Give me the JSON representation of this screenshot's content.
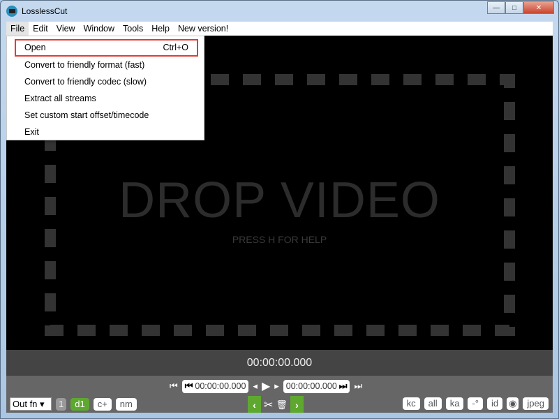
{
  "window": {
    "title": "LosslessCut",
    "minimize": "—",
    "maximize": "□",
    "close": "✕"
  },
  "menubar": [
    "File",
    "Edit",
    "View",
    "Window",
    "Tools",
    "Help",
    "New version!"
  ],
  "file_menu": [
    {
      "label": "Open",
      "shortcut": "Ctrl+O"
    },
    {
      "label": "Convert to friendly format (fast)",
      "shortcut": ""
    },
    {
      "label": "Convert to friendly codec (slow)",
      "shortcut": ""
    },
    {
      "label": "Extract all streams",
      "shortcut": ""
    },
    {
      "label": "Set custom start offset/timecode",
      "shortcut": ""
    },
    {
      "label": "Exit",
      "shortcut": ""
    }
  ],
  "stage": {
    "drop_text": "DROP VIDEO",
    "help_text": "PRESS H FOR HELP"
  },
  "timecode": "00:00:00.000",
  "controls": {
    "cut_start": "00:00:00.000",
    "cut_end": "00:00:00.000",
    "output_format": "Out fn",
    "segment_num": "1",
    "d1": "d1",
    "cplus": "c+",
    "nm": "nm",
    "prev": "‹",
    "next": "›",
    "kc": "kc",
    "all": "all",
    "ka": "ka",
    "rotate": "-°",
    "id": "id",
    "jpeg": "jpeg"
  }
}
